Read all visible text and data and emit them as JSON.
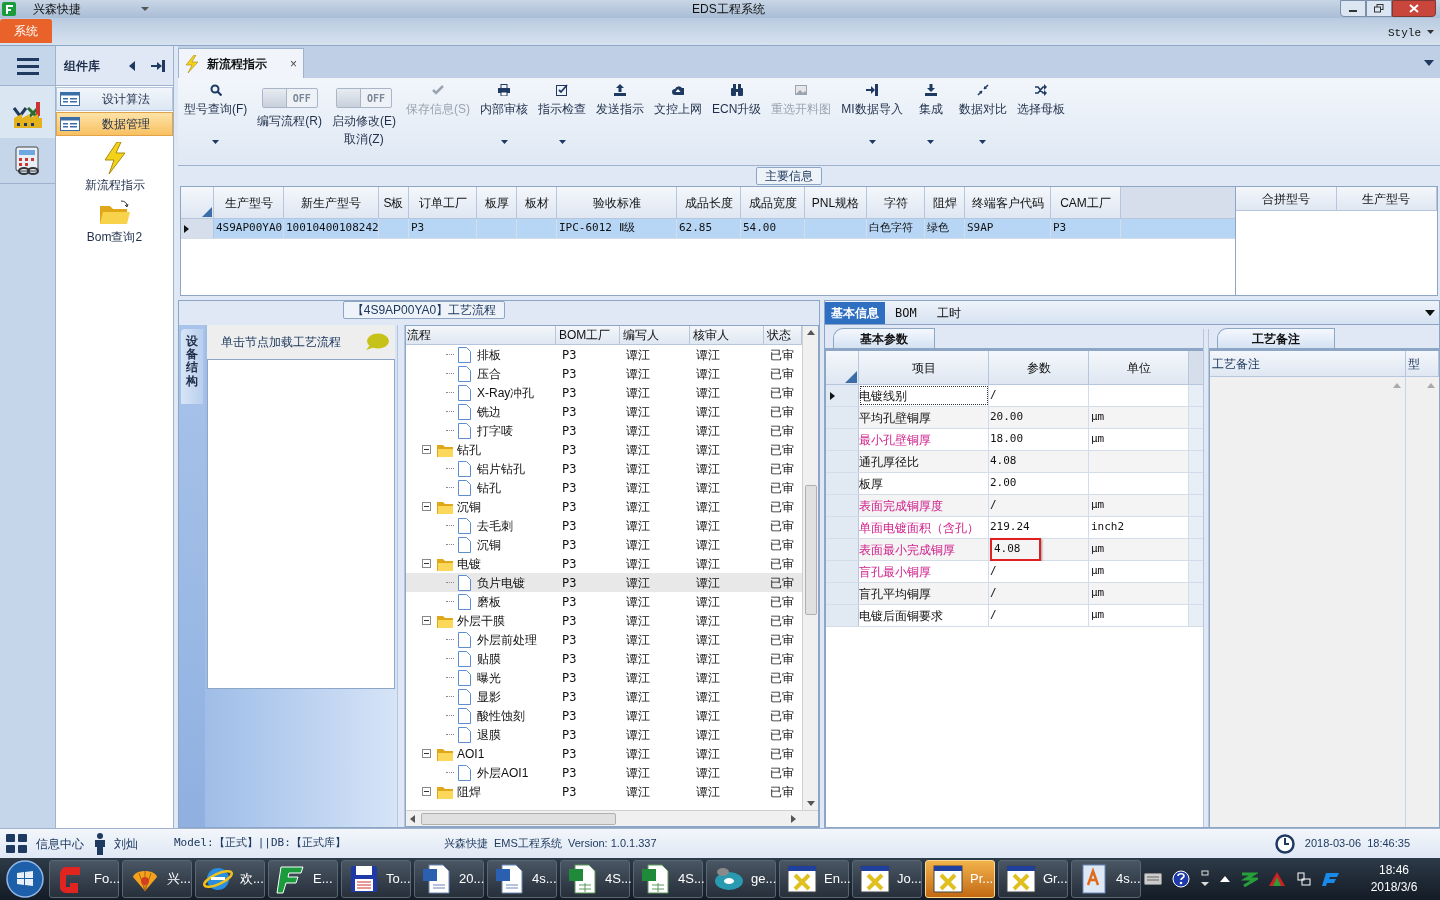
{
  "window": {
    "app_name": "兴森快捷",
    "title": "EDS工程系统"
  },
  "ribbon": {
    "tabs": [
      {
        "label": "系统",
        "selected": true
      }
    ],
    "style_label": "Style"
  },
  "component_panel": {
    "title": "组件库",
    "items": [
      {
        "label": "设计算法",
        "selected": false
      },
      {
        "label": "数据管理",
        "selected": true
      }
    ],
    "tools": [
      {
        "kind": "bolt",
        "label": "新流程指示"
      },
      {
        "kind": "folder",
        "label": "Bom查询2"
      }
    ]
  },
  "document_tab": {
    "label": "新流程指示",
    "close": "×"
  },
  "toolbar": [
    {
      "kind": "button",
      "label": "型号查询(F)",
      "dropdown": true,
      "disabled": false
    },
    {
      "kind": "toggle",
      "switch": "OFF",
      "on": false,
      "label": "编写流程(R)"
    },
    {
      "kind": "toggle",
      "switch": "OFF",
      "on": false,
      "label": "启动修改(E)\n取消(Z)"
    },
    {
      "kind": "button",
      "label": "保存信息(S)",
      "dropdown": false,
      "disabled": true
    },
    {
      "kind": "button",
      "label": "内部审核",
      "dropdown": true,
      "disabled": false
    },
    {
      "kind": "button",
      "label": "指示检查",
      "dropdown": true,
      "disabled": false
    },
    {
      "kind": "button",
      "label": "发送指示",
      "dropdown": false,
      "disabled": false
    },
    {
      "kind": "button",
      "label": "文控上网",
      "dropdown": false,
      "disabled": false
    },
    {
      "kind": "button",
      "label": "ECN升级",
      "dropdown": false,
      "disabled": false
    },
    {
      "kind": "button",
      "label": "重选开料图",
      "dropdown": false,
      "disabled": true
    },
    {
      "kind": "button",
      "label": "MI数据导入",
      "dropdown": true,
      "disabled": false
    },
    {
      "kind": "button",
      "label": "集成",
      "dropdown": true,
      "disabled": false
    },
    {
      "kind": "button",
      "label": "数据对比",
      "dropdown": true,
      "disabled": false
    },
    {
      "kind": "button",
      "label": "选择母板",
      "dropdown": false,
      "disabled": false
    }
  ],
  "main_info": {
    "legend": "主要信息",
    "columns": [
      "生产型号",
      "新生产型号",
      "S板",
      "订单工厂",
      "板厚",
      "板材",
      "验收标准",
      "成品长度",
      "成品宽度",
      "PNL规格",
      "字符",
      "阻焊",
      "终端客户代码",
      "CAM工厂"
    ],
    "rows": [
      {
        "selected": true,
        "cells": [
          "4S9AP00YA0",
          "10010400108242",
          null,
          "P3",
          null,
          null,
          "IPC-6012 Ⅱ级",
          "62.85",
          "54.00",
          null,
          "白色字符",
          "绿色",
          "S9AP",
          "P3"
        ]
      }
    ],
    "side_columns": [
      "合拼型号",
      "生产型号"
    ]
  },
  "process": {
    "title": "【4S9AP00YA0】工艺流程",
    "side_tab": "设备结构",
    "hint": "单击节点加载工艺流程",
    "columns": [
      "流程",
      "BOM工厂",
      "编写人",
      "核审人",
      "状态"
    ],
    "nodes": [
      {
        "kind": "leaf",
        "name": "排板",
        "factory": "P3",
        "author": "谭江",
        "reviewer": "谭江",
        "status": "已审",
        "selected": false
      },
      {
        "kind": "leaf",
        "name": "压合",
        "factory": "P3",
        "author": "谭江",
        "reviewer": "谭江",
        "status": "已审",
        "selected": false
      },
      {
        "kind": "leaf",
        "name": "X-Ray冲孔",
        "factory": "P3",
        "author": "谭江",
        "reviewer": "谭江",
        "status": "已审",
        "selected": false
      },
      {
        "kind": "leaf",
        "name": "铣边",
        "factory": "P3",
        "author": "谭江",
        "reviewer": "谭江",
        "status": "已审",
        "selected": false
      },
      {
        "kind": "leaf",
        "name": "打字唛",
        "factory": "P3",
        "author": "谭江",
        "reviewer": "谭江",
        "status": "已审",
        "selected": false
      },
      {
        "kind": "folder",
        "name": "钻孔",
        "factory": "P3",
        "author": "谭江",
        "reviewer": "谭江",
        "status": "已审",
        "selected": false,
        "expanded": true,
        "children": [
          {
            "kind": "leaf",
            "name": "铝片钻孔",
            "factory": "P3",
            "author": "谭江",
            "reviewer": "谭江",
            "status": "已审",
            "selected": false
          },
          {
            "kind": "leaf",
            "name": "钻孔",
            "factory": "P3",
            "author": "谭江",
            "reviewer": "谭江",
            "status": "已审",
            "selected": false
          }
        ]
      },
      {
        "kind": "folder",
        "name": "沉铜",
        "factory": "P3",
        "author": "谭江",
        "reviewer": "谭江",
        "status": "已审",
        "selected": false,
        "expanded": true,
        "children": [
          {
            "kind": "leaf",
            "name": "去毛刺",
            "factory": "P3",
            "author": "谭江",
            "reviewer": "谭江",
            "status": "已审",
            "selected": false
          },
          {
            "kind": "leaf",
            "name": "沉铜",
            "factory": "P3",
            "author": "谭江",
            "reviewer": "谭江",
            "status": "已审",
            "selected": false
          }
        ]
      },
      {
        "kind": "folder",
        "name": "电镀",
        "factory": "P3",
        "author": "谭江",
        "reviewer": "谭江",
        "status": "已审",
        "selected": false,
        "expanded": true,
        "children": [
          {
            "kind": "leaf",
            "name": "负片电镀",
            "factory": "P3",
            "author": "谭江",
            "reviewer": "谭江",
            "status": "已审",
            "selected": true
          },
          {
            "kind": "leaf",
            "name": "磨板",
            "factory": "P3",
            "author": "谭江",
            "reviewer": "谭江",
            "status": "已审",
            "selected": false
          }
        ]
      },
      {
        "kind": "folder",
        "name": "外层干膜",
        "factory": "P3",
        "author": "谭江",
        "reviewer": "谭江",
        "status": "已审",
        "selected": false,
        "expanded": true,
        "children": [
          {
            "kind": "leaf",
            "name": "外层前处理",
            "factory": "P3",
            "author": "谭江",
            "reviewer": "谭江",
            "status": "已审",
            "selected": false
          },
          {
            "kind": "leaf",
            "name": "贴膜",
            "factory": "P3",
            "author": "谭江",
            "reviewer": "谭江",
            "status": "已审",
            "selected": false
          },
          {
            "kind": "leaf",
            "name": "曝光",
            "factory": "P3",
            "author": "谭江",
            "reviewer": "谭江",
            "status": "已审",
            "selected": false
          },
          {
            "kind": "leaf",
            "name": "显影",
            "factory": "P3",
            "author": "谭江",
            "reviewer": "谭江",
            "status": "已审",
            "selected": false
          },
          {
            "kind": "leaf",
            "name": "酸性蚀刻",
            "factory": "P3",
            "author": "谭江",
            "reviewer": "谭江",
            "status": "已审",
            "selected": false
          },
          {
            "kind": "leaf",
            "name": "退膜",
            "factory": "P3",
            "author": "谭江",
            "reviewer": "谭江",
            "status": "已审",
            "selected": false
          }
        ]
      },
      {
        "kind": "folder",
        "name": "AOI1",
        "factory": "P3",
        "author": "谭江",
        "reviewer": "谭江",
        "status": "已审",
        "selected": false,
        "expanded": true,
        "children": [
          {
            "kind": "leaf",
            "name": "外层AOI1",
            "factory": "P3",
            "author": "谭江",
            "reviewer": "谭江",
            "status": "已审",
            "selected": false
          }
        ]
      },
      {
        "kind": "folder",
        "name": "阻焊",
        "factory": "P3",
        "author": "谭江",
        "reviewer": "谭江",
        "status": "已审",
        "selected": false,
        "expanded": true
      }
    ]
  },
  "details": {
    "tabs": [
      {
        "label": "基本信息",
        "selected": true
      },
      {
        "label": "BOM",
        "selected": false
      },
      {
        "label": "工时",
        "selected": false
      }
    ],
    "sub_tab": "基本参数",
    "columns": [
      "项目",
      "参数",
      "单位"
    ],
    "rows": [
      {
        "item": "电镀线别",
        "value": "/",
        "current": true,
        "required": false,
        "flagged": false
      },
      {
        "item": "平均孔壁铜厚",
        "value": "20.00",
        "unit": "μm",
        "current": false,
        "required": false,
        "flagged": false
      },
      {
        "item": "最小孔壁铜厚",
        "value": "18.00",
        "unit": "μm",
        "current": false,
        "required": true,
        "flagged": false
      },
      {
        "item": "通孔厚径比",
        "value": "4.08",
        "current": false,
        "required": false,
        "flagged": false
      },
      {
        "item": "板厚",
        "value": "2.00",
        "current": false,
        "required": false,
        "flagged": false
      },
      {
        "item": "表面完成铜厚度",
        "value": "/",
        "unit": "μm",
        "current": false,
        "required": true,
        "flagged": false
      },
      {
        "item": "单面电镀面积（含孔）",
        "value": "219.24",
        "unit": "inch2",
        "current": false,
        "required": true,
        "flagged": false
      },
      {
        "item": "表面最小完成铜厚",
        "value": "4.08",
        "unit": "μm",
        "current": false,
        "required": true,
        "flagged": true
      },
      {
        "item": "盲孔最小铜厚",
        "value": "/",
        "unit": "μm",
        "current": false,
        "required": true,
        "flagged": false
      },
      {
        "item": "盲孔平均铜厚",
        "value": "/",
        "unit": "μm",
        "current": false,
        "required": false,
        "flagged": false
      },
      {
        "item": "电镀后面铜要求",
        "value": "/",
        "unit": "μm",
        "current": false,
        "required": false,
        "flagged": false
      }
    ],
    "notes": {
      "tab": "工艺备注",
      "columns": [
        "工艺备注",
        "型"
      ]
    }
  },
  "status_bar": {
    "info_center": "信息中心",
    "user": "刘灿",
    "mode": "Model:【正式】||DB:【正式库】",
    "version": "兴森快捷  EMS工程系统  Version: 1.0.1.337",
    "datetime": "2018-03-06  18:46:35"
  },
  "taskbar": {
    "items": [
      {
        "label": "Fo...",
        "selected": false
      },
      {
        "label": "兴...",
        "selected": false
      },
      {
        "label": "欢...",
        "selected": false
      },
      {
        "label": "E...",
        "selected": false
      },
      {
        "label": "To...",
        "selected": false
      },
      {
        "label": "20...",
        "selected": false
      },
      {
        "label": "4s...",
        "selected": false
      },
      {
        "label": "4S...",
        "selected": false
      },
      {
        "label": "4S...",
        "selected": false
      },
      {
        "label": "ge...",
        "selected": false
      },
      {
        "label": "En...",
        "selected": false
      },
      {
        "label": "Jo...",
        "selected": false
      },
      {
        "label": "Pr...",
        "selected": true
      },
      {
        "label": "Gr...",
        "selected": false
      },
      {
        "label": "4s...",
        "selected": false
      }
    ],
    "time": "18:46",
    "date": "2018/3/6"
  }
}
